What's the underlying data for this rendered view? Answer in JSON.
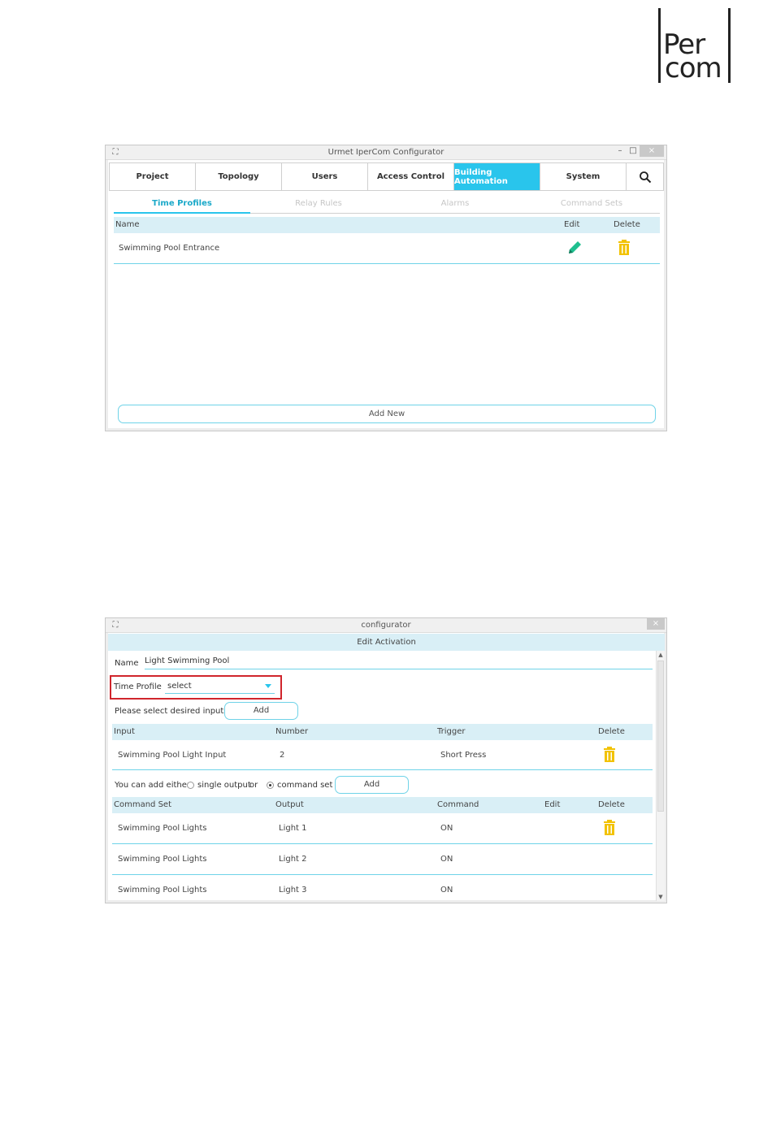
{
  "logo": {
    "line1": "Per",
    "line2": "com"
  },
  "window1": {
    "title": "Urmet IperCom Configurator",
    "controls": {
      "minimize": "–",
      "maximize": "□",
      "close": "×"
    },
    "nav": [
      "Project",
      "Topology",
      "Users",
      "Access Control",
      "Building Automation",
      "System"
    ],
    "active_nav": "Building Automation",
    "subtabs": [
      "Time Profiles",
      "Relay Rules",
      "Alarms",
      "Command Sets"
    ],
    "active_subtab": "Time Profiles",
    "table": {
      "headers": {
        "name": "Name",
        "edit": "Edit",
        "delete": "Delete"
      },
      "rows": [
        {
          "name": "Swimming Pool Entrance"
        }
      ]
    },
    "add_new": "Add New"
  },
  "window2": {
    "title": "configurator",
    "controls": {
      "close": "×"
    },
    "header": "Edit Activation",
    "name_label": "Name",
    "name_value": "Light Swimming Pool",
    "time_profile_label": "Time Profile",
    "time_profile_value": "select",
    "inputs_prompt": "Please select desired inputs",
    "add_input": "Add",
    "inputs_table": {
      "headers": {
        "input": "Input",
        "number": "Number",
        "trigger": "Trigger",
        "delete": "Delete"
      },
      "rows": [
        {
          "input": "Swimming Pool Light Input",
          "number": "2",
          "trigger": "Short Press"
        }
      ]
    },
    "add_either": {
      "prefix": "You can add either",
      "option1": "single output",
      "or": "or",
      "option2": "command set",
      "selected": "command set",
      "add": "Add"
    },
    "commands_table": {
      "headers": {
        "command_set": "Command Set",
        "output": "Output",
        "command": "Command",
        "edit": "Edit",
        "delete": "Delete"
      },
      "rows": [
        {
          "command_set": "Swimming Pool Lights",
          "output": "Light 1",
          "command": "ON"
        },
        {
          "command_set": "Swimming Pool Lights",
          "output": "Light 2",
          "command": "ON"
        },
        {
          "command_set": "Swimming Pool Lights",
          "output": "Light 3",
          "command": "ON"
        }
      ]
    }
  },
  "colors": {
    "accent": "#29c5ec",
    "edit_icon": "#1fbf8f",
    "trash_icon": "#f2c200",
    "highlight": "#d0252c"
  },
  "icons": {
    "search": "search-icon",
    "edit": "pencil-icon",
    "delete": "trash-icon"
  }
}
